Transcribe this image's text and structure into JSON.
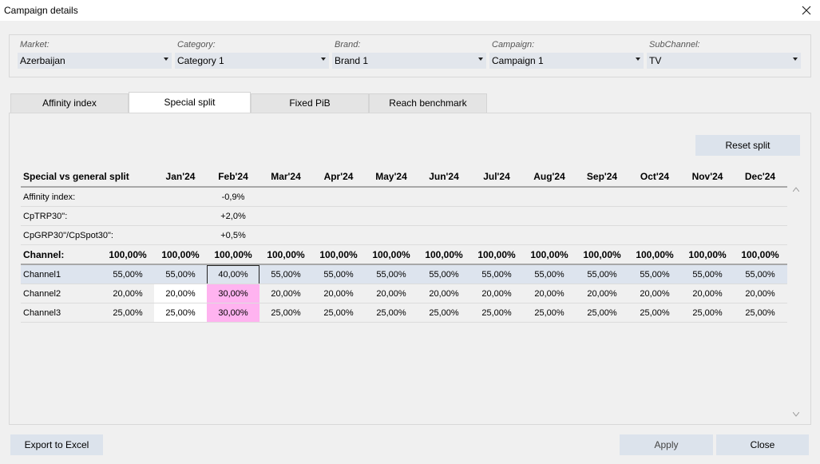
{
  "window": {
    "title": "Campaign details"
  },
  "filters": [
    {
      "label": "Market:",
      "value": "Azerbaijan"
    },
    {
      "label": "Category:",
      "value": "Category 1"
    },
    {
      "label": "Brand:",
      "value": "Brand 1"
    },
    {
      "label": "Campaign:",
      "value": "Campaign 1"
    },
    {
      "label": "SubChannel:",
      "value": "TV"
    }
  ],
  "tabs": [
    "Affinity index",
    "Special split",
    "Fixed PiB",
    "Reach benchmark"
  ],
  "active_tab": "Special split",
  "reset_label": "Reset split",
  "grid": {
    "header": [
      "Special vs general split",
      "Jan'24",
      "Feb'24",
      "Mar'24",
      "Apr'24",
      "May'24",
      "Jun'24",
      "Jul'24",
      "Aug'24",
      "Sep'24",
      "Oct'24",
      "Nov'24",
      "Dec'24"
    ],
    "info_rows": [
      {
        "label": "Affinity index:",
        "feb": "-0,9%"
      },
      {
        "label": "CpTRP30\":",
        "feb": "+2,0%"
      },
      {
        "label": "CpGRP30\"/CpSpot30\":",
        "feb": "+0,5%"
      }
    ],
    "total_row": {
      "label": "Channel:",
      "values": [
        "100,00%",
        "100,00%",
        "100,00%",
        "100,00%",
        "100,00%",
        "100,00%",
        "100,00%",
        "100,00%",
        "100,00%",
        "100,00%",
        "100,00%",
        "100,00%",
        "100,00%"
      ]
    },
    "channel_rows": [
      {
        "label": "Channel1",
        "values": [
          "55,00%",
          "55,00%",
          "40,00%",
          "55,00%",
          "55,00%",
          "55,00%",
          "55,00%",
          "55,00%",
          "55,00%",
          "55,00%",
          "55,00%",
          "55,00%",
          "55,00%"
        ]
      },
      {
        "label": "Channel2",
        "values": [
          "20,00%",
          "20,00%",
          "30,00%",
          "20,00%",
          "20,00%",
          "20,00%",
          "20,00%",
          "20,00%",
          "20,00%",
          "20,00%",
          "20,00%",
          "20,00%",
          "20,00%"
        ]
      },
      {
        "label": "Channel3",
        "values": [
          "25,00%",
          "25,00%",
          "30,00%",
          "25,00%",
          "25,00%",
          "25,00%",
          "25,00%",
          "25,00%",
          "25,00%",
          "25,00%",
          "25,00%",
          "25,00%",
          "25,00%"
        ]
      }
    ]
  },
  "colors": {
    "selected_row": "#dde4ee",
    "highlight_cell": "#ffb3f0",
    "button_bg": "#dce3ec"
  },
  "footer": {
    "export_label": "Export to Excel",
    "apply_label": "Apply",
    "close_label": "Close"
  }
}
